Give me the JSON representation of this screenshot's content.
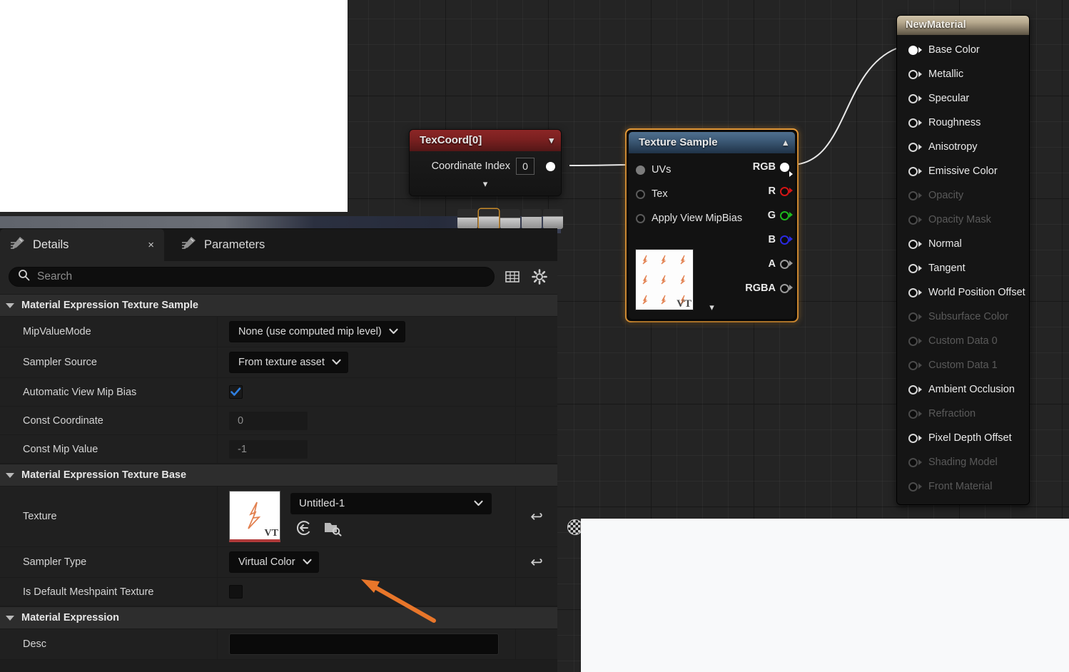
{
  "graph": {
    "nodes": {
      "texcoord": {
        "title": "TexCoord[0]",
        "coordinate_index_label": "Coordinate Index",
        "coordinate_index_value": "0",
        "title_color": "#7a2020"
      },
      "texture_sample": {
        "title": "Texture Sample",
        "selected_outline_color": "#f2a23a",
        "inputs": [
          {
            "label": "UVs",
            "pin": "filled-gray",
            "connected": true
          },
          {
            "label": "Tex",
            "pin": "ring-dark",
            "connected": false
          },
          {
            "label": "Apply View MipBias",
            "pin": "ring-dark",
            "connected": false
          }
        ],
        "outputs": [
          {
            "label": "RGB",
            "pin": "filled-white",
            "color": "#ffffff"
          },
          {
            "label": "R",
            "pin": "ring",
            "color": "#d41515"
          },
          {
            "label": "G",
            "pin": "ring",
            "color": "#1db81d"
          },
          {
            "label": "B",
            "pin": "ring",
            "color": "#2a2ae0"
          },
          {
            "label": "A",
            "pin": "ring",
            "color": "#9a9a9a"
          },
          {
            "label": "RGBA",
            "pin": "ring",
            "color": "#9a9a9a"
          }
        ],
        "preview_badge": "VT"
      },
      "new_material": {
        "title": "NewMaterial",
        "inputs": [
          {
            "label": "Base Color",
            "enabled": true,
            "connected": true
          },
          {
            "label": "Metallic",
            "enabled": true,
            "connected": false
          },
          {
            "label": "Specular",
            "enabled": true,
            "connected": false
          },
          {
            "label": "Roughness",
            "enabled": true,
            "connected": false
          },
          {
            "label": "Anisotropy",
            "enabled": true,
            "connected": false
          },
          {
            "label": "Emissive Color",
            "enabled": true,
            "connected": false
          },
          {
            "label": "Opacity",
            "enabled": false,
            "connected": false
          },
          {
            "label": "Opacity Mask",
            "enabled": false,
            "connected": false
          },
          {
            "label": "Normal",
            "enabled": true,
            "connected": false
          },
          {
            "label": "Tangent",
            "enabled": true,
            "connected": false
          },
          {
            "label": "World Position Offset",
            "enabled": true,
            "connected": false
          },
          {
            "label": "Subsurface Color",
            "enabled": false,
            "connected": false
          },
          {
            "label": "Custom Data 0",
            "enabled": false,
            "connected": false
          },
          {
            "label": "Custom Data 1",
            "enabled": false,
            "connected": false
          },
          {
            "label": "Ambient Occlusion",
            "enabled": true,
            "connected": false
          },
          {
            "label": "Refraction",
            "enabled": false,
            "connected": false
          },
          {
            "label": "Pixel Depth Offset",
            "enabled": true,
            "connected": false
          },
          {
            "label": "Shading Model",
            "enabled": false,
            "connected": false
          },
          {
            "label": "Front Material",
            "enabled": false,
            "connected": false
          }
        ]
      }
    }
  },
  "details": {
    "tabs": [
      {
        "label": "Details",
        "icon": "details-icon",
        "active": true,
        "closable": true
      },
      {
        "label": "Parameters",
        "icon": "parameters-icon",
        "active": false,
        "closable": false
      }
    ],
    "close_glyph": "×",
    "search": {
      "placeholder": "Search",
      "value": "",
      "icon": "search-icon"
    },
    "toolbar_icons": [
      {
        "name": "column-settings-icon"
      },
      {
        "name": "gear-icon"
      }
    ],
    "sections": [
      {
        "title": "Material Expression Texture Sample",
        "rows": [
          {
            "name": "MipValueMode",
            "type": "combo",
            "value": "None (use computed mip level)",
            "reset": false
          },
          {
            "name": "Sampler Source",
            "type": "combo",
            "value": "From texture asset",
            "reset": false
          },
          {
            "name": "Automatic View Mip Bias",
            "type": "checkbox",
            "value": "checked",
            "check_color": "#2f7fe0",
            "reset": false
          },
          {
            "name": "Const Coordinate",
            "type": "number",
            "value": "0",
            "reset": false
          },
          {
            "name": "Const Mip Value",
            "type": "number",
            "value": "-1",
            "reset": false
          }
        ]
      },
      {
        "title": "Material Expression Texture Base",
        "rows": [
          {
            "name": "Texture",
            "type": "asset",
            "value": "Untitled-1",
            "thumb_badge": "VT",
            "reset": true,
            "actions": [
              "browse-to-asset-icon",
              "use-selected-asset-icon"
            ]
          },
          {
            "name": "Sampler Type",
            "type": "combo",
            "value": "Virtual Color",
            "reset": true
          },
          {
            "name": "Is Default Meshpaint Texture",
            "type": "checkbox",
            "value": "unchecked",
            "reset": false
          }
        ]
      },
      {
        "title": "Material Expression",
        "rows": [
          {
            "name": "Desc",
            "type": "text",
            "value": "",
            "reset": false
          }
        ]
      }
    ],
    "reset_glyph": "↩"
  },
  "annotation": {
    "arrow_color": "#e8762a",
    "points_at": "Sampler Type combo box"
  },
  "colors": {
    "canvas_bg": "#242424",
    "panel_bg": "#242424",
    "node_bg": "#151515",
    "selection": "#f2a23a",
    "wire": "#f0f0f0"
  }
}
